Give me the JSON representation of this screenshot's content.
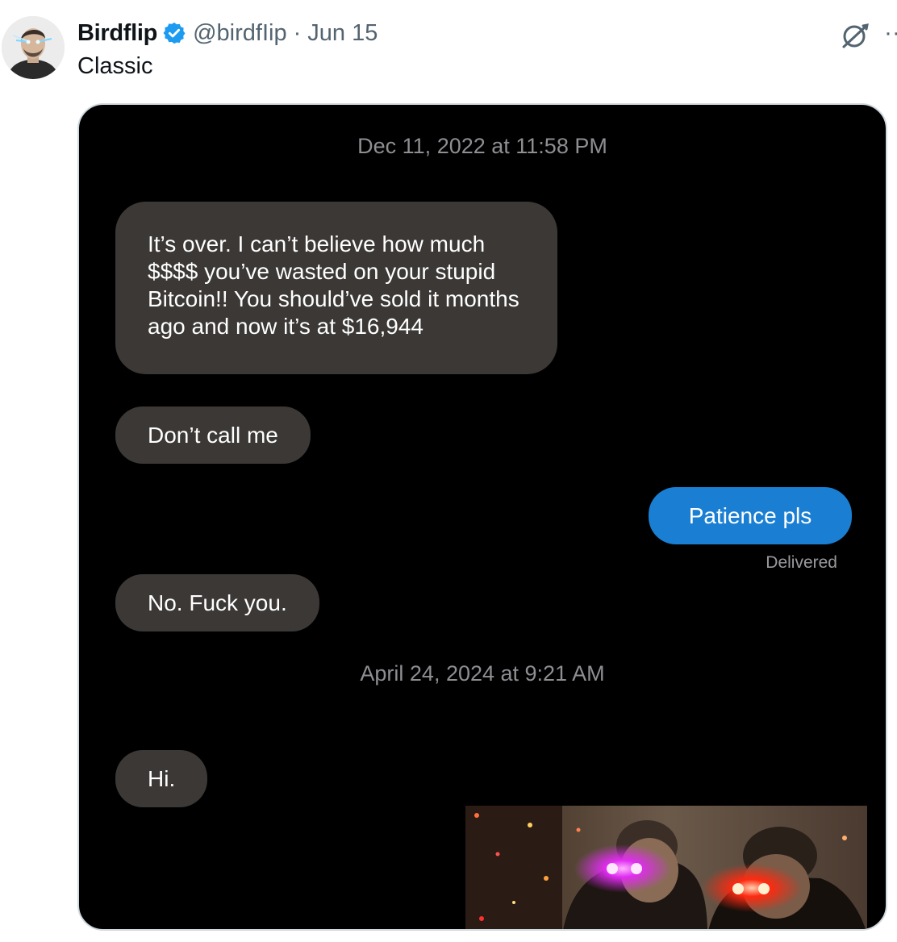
{
  "tweet": {
    "author_name": "Birdflip",
    "handle": "@birdfIip",
    "separator": "·",
    "date": "Jun 15",
    "text": "Classic",
    "more_label": "··",
    "verified_color": "#1d9bf0"
  },
  "media": {
    "messages_screenshot": {
      "timestamp_1": "Dec 11, 2022 at 11:58 PM",
      "received_1": "It’s over. I can’t believe how much $$$$ you’ve wasted on your stupid Bitcoin!! You should’ve sold it months ago and now it’s at $16,944",
      "received_2": "Don’t call me",
      "sent_1": "Patience pls",
      "sent_status": "Delivered",
      "received_3": "No. Fuck you.",
      "timestamp_2": "April 24, 2024 at 9:21 AM",
      "received_4": "Hi.",
      "received_bubble_color": "#3b3836",
      "sent_bubble_color": "#1a7fd3"
    }
  }
}
